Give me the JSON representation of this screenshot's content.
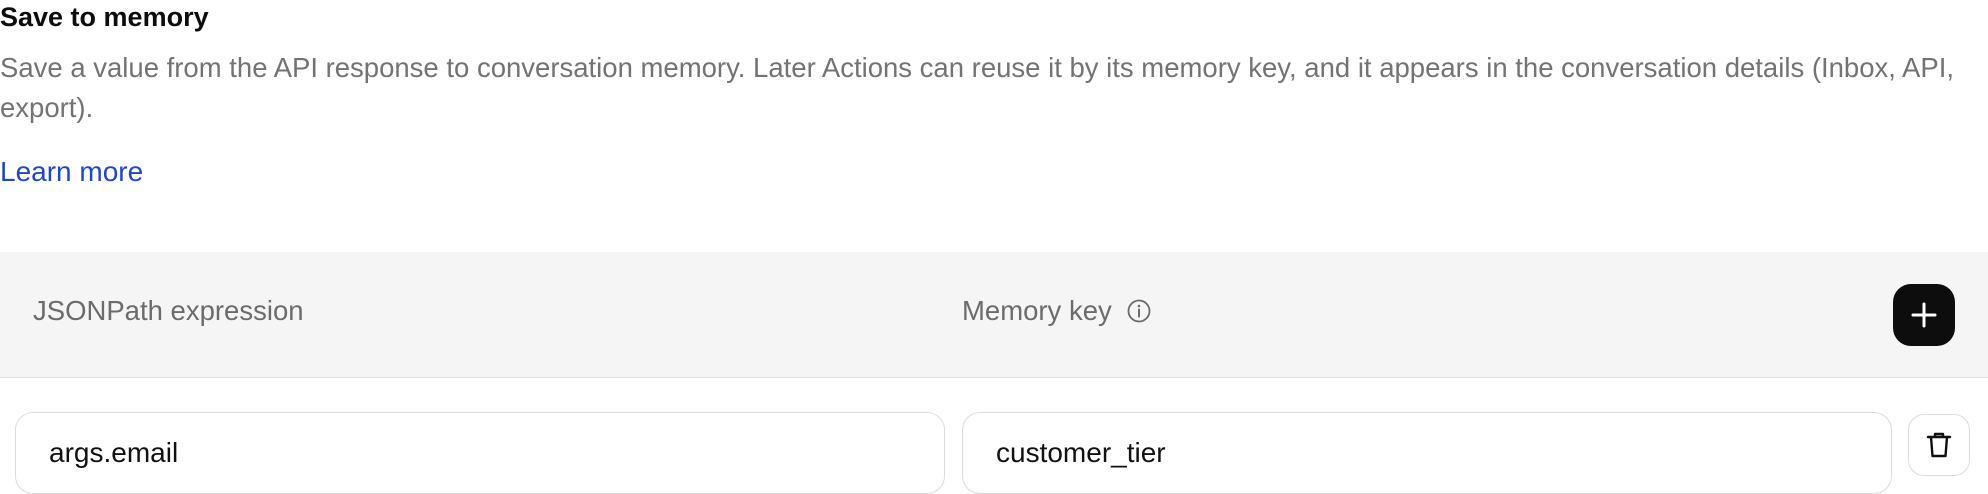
{
  "section": {
    "title": "Save to memory",
    "description": "Save a value from the API response to conversation memory. Later Actions can reuse it by its memory key, and it appears in the conversation details (Inbox, API, export).",
    "learn_more": "Learn more"
  },
  "table": {
    "columns": {
      "jsonpath": "JSONPath expression",
      "memory_key": "Memory key"
    },
    "header_icons": {
      "memory_key_info": "info-icon",
      "add": "plus-icon"
    },
    "rows": [
      {
        "jsonpath": "args.email",
        "memory_key": "customer_tier",
        "delete_icon": "trash-icon"
      }
    ]
  },
  "colors": {
    "link": "#2046c8",
    "header_bg": "#f5f5f5",
    "add_button_bg": "#0d0d0d",
    "muted_text": "#737373"
  }
}
